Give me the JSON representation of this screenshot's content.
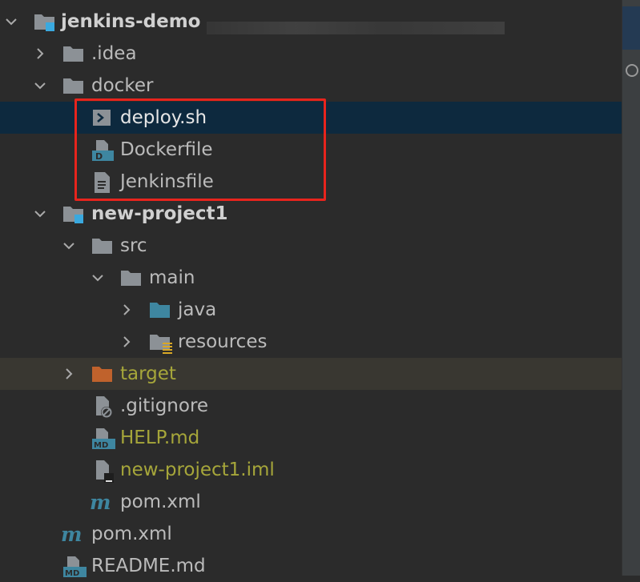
{
  "tree": {
    "project": "jenkins-demo",
    "items": [
      {
        "label": ".idea",
        "icon": "folder-icon"
      },
      {
        "label": "docker",
        "icon": "folder-icon"
      },
      {
        "label": "deploy.sh",
        "icon": "shell-script-icon"
      },
      {
        "label": "Dockerfile",
        "icon": "dockerfile-icon"
      },
      {
        "label": "Jenkinsfile",
        "icon": "text-file-icon"
      },
      {
        "label": "new-project1",
        "icon": "module-folder-icon"
      },
      {
        "label": "src",
        "icon": "folder-icon"
      },
      {
        "label": "main",
        "icon": "folder-icon"
      },
      {
        "label": "java",
        "icon": "source-folder-icon"
      },
      {
        "label": "resources",
        "icon": "resources-folder-icon"
      },
      {
        "label": "target",
        "icon": "excluded-folder-icon"
      },
      {
        "label": ".gitignore",
        "icon": "gitignore-icon"
      },
      {
        "label": "HELP.md",
        "icon": "markdown-icon"
      },
      {
        "label": "new-project1.iml",
        "icon": "iml-file-icon"
      },
      {
        "label": "pom.xml",
        "icon": "maven-icon"
      },
      {
        "label": "pom.xml",
        "icon": "maven-icon"
      },
      {
        "label": "README.md",
        "icon": "markdown-icon"
      }
    ]
  },
  "colors": {
    "background": "#2b2b2b",
    "selection": "#0d293e",
    "excluded_row": "#393731",
    "highlight_box": "#e8241d",
    "untracked_text": "#a6a63a",
    "folder": "#8c9196",
    "source_folder": "#3e86a0",
    "excluded_folder": "#c0622c"
  }
}
